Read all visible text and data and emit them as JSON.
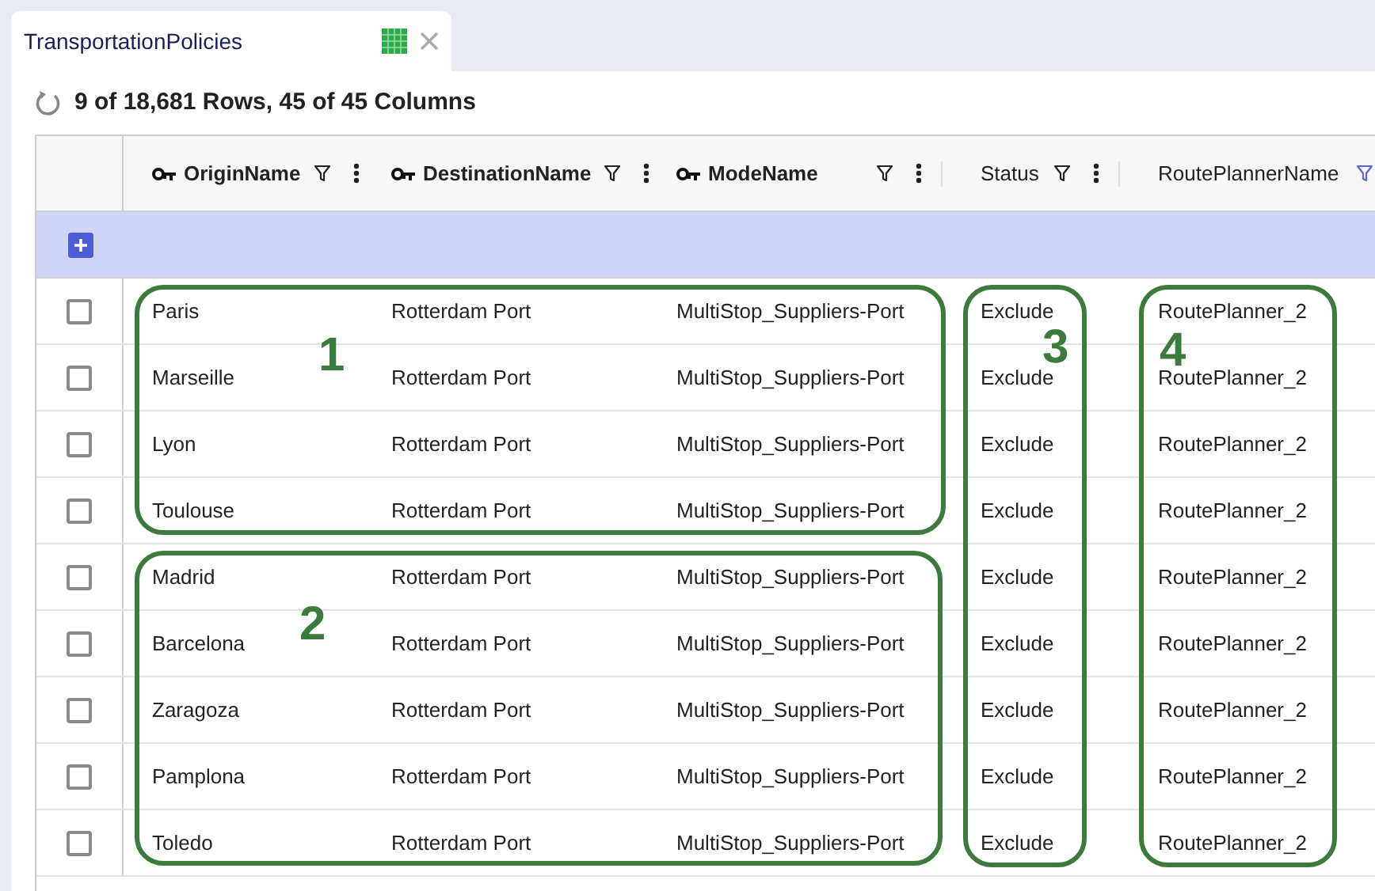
{
  "tab": {
    "title": "TransportationPolicies"
  },
  "status_line": "9 of 18,681 Rows, 45 of 45 Columns",
  "columns": [
    {
      "label": "OriginName",
      "key": true,
      "filter_active": false,
      "menu": true
    },
    {
      "label": "DestinationName",
      "key": true,
      "filter_active": false,
      "menu": true
    },
    {
      "label": "ModeName",
      "key": true,
      "filter_active": false,
      "menu": true
    },
    {
      "label": "Status",
      "key": false,
      "filter_active": false,
      "menu": true
    },
    {
      "label": "RoutePlannerName",
      "key": false,
      "filter_active": true,
      "menu": false
    }
  ],
  "rows": [
    {
      "checked": false,
      "cells": [
        "Paris",
        "Rotterdam Port",
        "MultiStop_Suppliers-Port",
        "Exclude",
        "RoutePlanner_2"
      ]
    },
    {
      "checked": false,
      "cells": [
        "Marseille",
        "Rotterdam Port",
        "MultiStop_Suppliers-Port",
        "Exclude",
        "RoutePlanner_2"
      ]
    },
    {
      "checked": false,
      "cells": [
        "Lyon",
        "Rotterdam Port",
        "MultiStop_Suppliers-Port",
        "Exclude",
        "RoutePlanner_2"
      ]
    },
    {
      "checked": false,
      "cells": [
        "Toulouse",
        "Rotterdam Port",
        "MultiStop_Suppliers-Port",
        "Exclude",
        "RoutePlanner_2"
      ]
    },
    {
      "checked": false,
      "cells": [
        "Madrid",
        "Rotterdam Port",
        "MultiStop_Suppliers-Port",
        "Exclude",
        "RoutePlanner_2"
      ]
    },
    {
      "checked": false,
      "cells": [
        "Barcelona",
        "Rotterdam Port",
        "MultiStop_Suppliers-Port",
        "Exclude",
        "RoutePlanner_2"
      ]
    },
    {
      "checked": false,
      "cells": [
        "Zaragoza",
        "Rotterdam Port",
        "MultiStop_Suppliers-Port",
        "Exclude",
        "RoutePlanner_2"
      ]
    },
    {
      "checked": false,
      "cells": [
        "Pamplona",
        "Rotterdam Port",
        "MultiStop_Suppliers-Port",
        "Exclude",
        "RoutePlanner_2"
      ]
    },
    {
      "checked": false,
      "cells": [
        "Toledo",
        "Rotterdam Port",
        "MultiStop_Suppliers-Port",
        "Exclude",
        "RoutePlanner_2"
      ]
    }
  ],
  "annotations": [
    {
      "label": "1"
    },
    {
      "label": "2"
    },
    {
      "label": "3"
    },
    {
      "label": "4"
    }
  ]
}
